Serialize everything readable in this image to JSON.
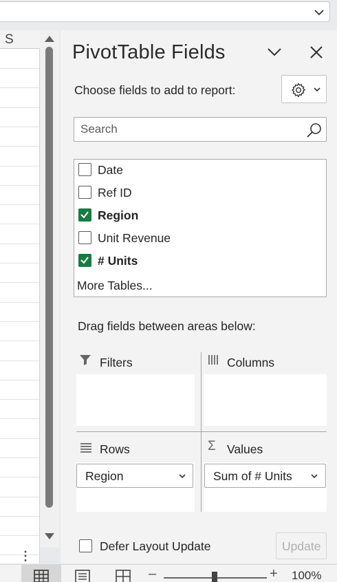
{
  "sheet": {
    "column_letter": "S"
  },
  "pane": {
    "title": "PivotTable Fields",
    "choose_label": "Choose fields to add to report:",
    "search_placeholder": "Search",
    "fields": [
      {
        "label": "Date",
        "checked": false
      },
      {
        "label": "Ref ID",
        "checked": false
      },
      {
        "label": "Region",
        "checked": true
      },
      {
        "label": "Unit Revenue",
        "checked": false
      },
      {
        "label": "# Units",
        "checked": true
      }
    ],
    "more_tables": "More Tables...",
    "drag_label": "Drag fields between areas below:",
    "areas": {
      "filters": "Filters",
      "columns": "Columns",
      "rows": "Rows",
      "values": "Values"
    },
    "rows_chip": "Region",
    "values_chip": "Sum of # Units",
    "defer_label": "Defer Layout Update",
    "update_label": "Update"
  },
  "status": {
    "zoom_minus": "–",
    "zoom_plus": "+",
    "zoom_percent": "100%",
    "zoom_value": 100
  },
  "colors": {
    "check_green": "#1a7a43",
    "pane_bg": "#f3f3f3"
  },
  "icons": [
    "chevron-down-icon",
    "close-icon",
    "gear-icon",
    "search-icon",
    "filter-icon",
    "columns-icon",
    "rows-icon",
    "sigma-icon",
    "normal-view-icon",
    "page-layout-icon",
    "page-break-icon"
  ]
}
